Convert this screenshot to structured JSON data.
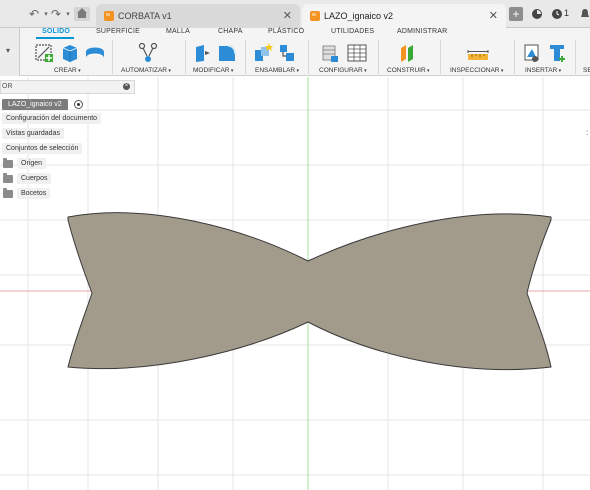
{
  "tabs": {
    "doc1_title": "CORBATA v1",
    "doc2_title": "LAZO_ignaico v2",
    "close_glyph": "✕",
    "plus_glyph": "+",
    "notification_count": "1"
  },
  "ribbon": {
    "tabs": [
      "SOLIDO",
      "SUPERFICIE",
      "MALLA",
      "CHAPA",
      "PLÁSTICO",
      "UTILIDADES",
      "ADMINISTRAR"
    ],
    "groups": [
      "CREAR",
      "AUTOMATIZAR",
      "MODIFICAR",
      "ENSAMBLAR",
      "CONFIGURAR",
      "CONSTRUIR",
      "INSPECCIONAR",
      "INSERTAR",
      "SE"
    ]
  },
  "browser": {
    "header_label": "OR",
    "root_node": "LAZO_ignaico v2",
    "items": [
      "Configuración del documento",
      "Vistas guardadas",
      "Conjuntos de selección",
      "Origen",
      "Cuerpos",
      "Bocetos"
    ]
  },
  "colors": {
    "accent": "#0696d7",
    "body_fill": "#a29b8c",
    "axis_red": "#e8a7a7",
    "axis_green": "#a8d8a2",
    "grid": "#e6e6e6"
  }
}
